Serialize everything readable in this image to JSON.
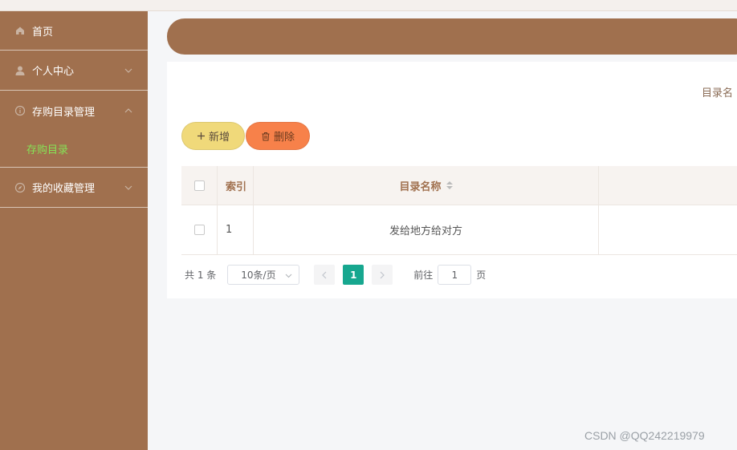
{
  "sidebar": {
    "items": [
      {
        "label": "首页",
        "icon": "home-icon"
      },
      {
        "label": "个人中心",
        "icon": "user-icon"
      },
      {
        "label": "存购目录管理",
        "icon": "info-icon",
        "expanded": true,
        "children": [
          {
            "label": "存购目录",
            "active": true
          }
        ]
      },
      {
        "label": "我的收藏管理",
        "icon": "compass-icon"
      }
    ]
  },
  "search": {
    "label": "目录名"
  },
  "toolbar": {
    "add_label": "新增",
    "delete_label": "删除"
  },
  "table": {
    "columns": [
      "索引",
      "目录名称"
    ],
    "rows": [
      {
        "index": "1",
        "name": "发给地方给对方"
      }
    ]
  },
  "pagination": {
    "total_text": "共 1 条",
    "page_size": "10条/页",
    "current_page": "1",
    "goto_prefix": "前往",
    "goto_value": "1",
    "goto_suffix": "页"
  },
  "watermark": "CSDN @QQ242219979",
  "colors": {
    "primary": "#a0704e",
    "add_button": "#f0d97a",
    "delete_button": "#f7814a",
    "page_active": "#17a78f",
    "submenu_active": "#86e356"
  }
}
